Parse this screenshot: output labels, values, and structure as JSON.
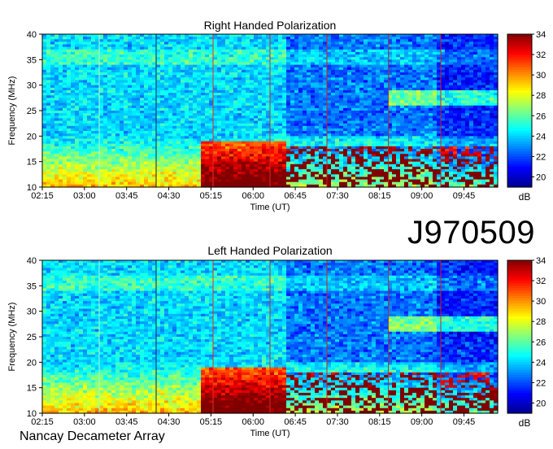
{
  "page": {
    "observation_id": "J970509",
    "instrument": "Nancay Decameter Array"
  },
  "colors": {
    "colormap": [
      "#00008f",
      "#0000ff",
      "#0080ff",
      "#00ffff",
      "#80ff80",
      "#ffff00",
      "#ff8000",
      "#ff0000",
      "#800000"
    ]
  },
  "chart_data": [
    {
      "type": "heatmap",
      "title": "Right Handed Polarization",
      "xlabel": "Time (UT)",
      "ylabel": "Frequency (MHz)",
      "x_ticks": [
        "02:15",
        "03:00",
        "03:45",
        "04:30",
        "05:15",
        "06:00",
        "06:45",
        "07:30",
        "08:15",
        "09:00",
        "09:45"
      ],
      "y_ticks": [
        10,
        15,
        20,
        25,
        30,
        35,
        40
      ],
      "ylim": [
        10,
        40
      ],
      "colorbar_label": "dB",
      "colorbar_ticks": [
        20,
        22,
        24,
        26,
        28,
        30,
        32,
        34
      ],
      "colorbar_range": [
        19,
        34
      ]
    },
    {
      "type": "heatmap",
      "title": "Left Handed Polarization",
      "xlabel": "Time (UT)",
      "ylabel": "Frequency (MHz)",
      "x_ticks": [
        "02:15",
        "03:00",
        "03:45",
        "04:30",
        "05:15",
        "06:00",
        "06:45",
        "07:30",
        "08:15",
        "09:00",
        "09:45"
      ],
      "y_ticks": [
        10,
        15,
        20,
        25,
        30,
        35,
        40
      ],
      "ylim": [
        10,
        40
      ],
      "colorbar_label": "dB",
      "colorbar_ticks": [
        20,
        22,
        24,
        26,
        28,
        30,
        32,
        34
      ],
      "colorbar_range": [
        19,
        34
      ]
    }
  ]
}
